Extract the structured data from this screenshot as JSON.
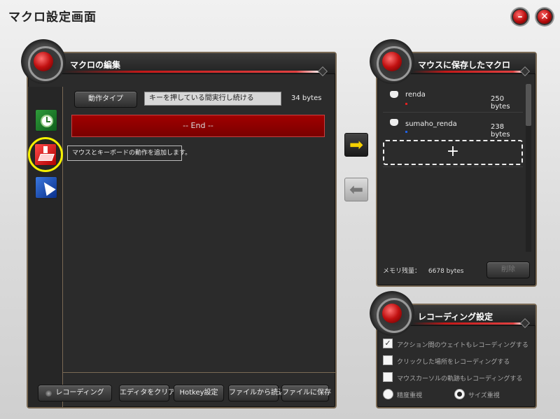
{
  "window": {
    "title": "マクロ設定画面",
    "minimize_glyph": "–",
    "close_glyph": "✕"
  },
  "editor": {
    "title": "マクロの編集",
    "action_type_label": "動作タイプ",
    "action_type_value": "キーを押している間実行し続ける",
    "size": "34 bytes",
    "end_label": "-- End --",
    "tooltip": "マウスとキーボードの動作を追加します。",
    "sidebar_icons": [
      "clock-delay-icon",
      "keyboard-action-icon",
      "mouse-cursor-icon"
    ],
    "buttons": {
      "recording": "レコーディング",
      "clear": "エディタをクリア",
      "hotkey": "Hotkey設定",
      "load": "ファイルから読込",
      "save": "ファイルに保存"
    }
  },
  "transfer": {
    "to_mouse": "➡",
    "to_editor": "⬅"
  },
  "mouse_macros": {
    "title": "マウスに保存したマクロ",
    "items": [
      {
        "name": "renda",
        "size": "250 bytes",
        "dot_color": "#e02020"
      },
      {
        "name": "sumaho_renda",
        "size": "238 bytes",
        "dot_color": "#2060e0"
      }
    ],
    "add_glyph": "+",
    "memory_label": "メモリ残量：",
    "memory_value": "6678 bytes",
    "delete_label": "削除"
  },
  "recording_settings": {
    "title": "レコーディング設定",
    "options": [
      {
        "label": "アクション間のウェイトもレコーディングする",
        "checked": true
      },
      {
        "label": "クリックした場所をレコーディングする",
        "checked": false
      },
      {
        "label": "マウスカーソルの軌跡もレコーディングする",
        "checked": false
      }
    ],
    "mode_options": [
      {
        "label": "精度重視",
        "selected": false
      },
      {
        "label": "サイズ重視",
        "selected": true
      }
    ],
    "check_glyph": "✓"
  }
}
